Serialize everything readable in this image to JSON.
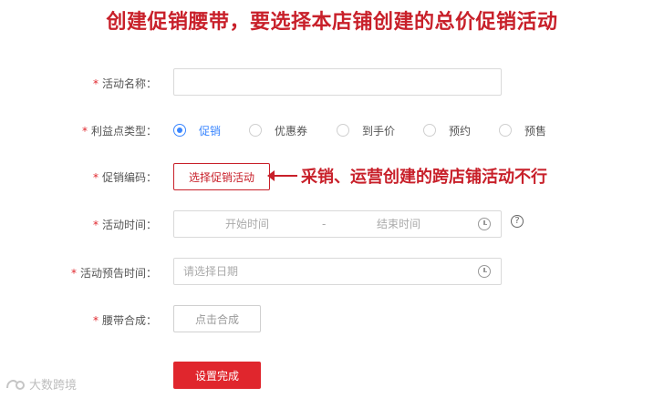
{
  "headline": "创建促销腰带，要选择本店铺创建的总价促销活动",
  "form": {
    "activity_name": {
      "label": "活动名称：",
      "value": "",
      "placeholder": ""
    },
    "benefit_type": {
      "label": "利益点类型：",
      "options": [
        "促销",
        "优惠券",
        "到手价",
        "预约",
        "预售"
      ],
      "selected": "促销"
    },
    "promo_code": {
      "label": "促销编码：",
      "button_label": "选择促销活动"
    },
    "activity_time": {
      "label": "活动时间：",
      "start_placeholder": "开始时间",
      "separator": "-",
      "end_placeholder": "结束时间"
    },
    "preview_time": {
      "label": "活动预告时间：",
      "placeholder": "请选择日期"
    },
    "banner": {
      "label": "腰带合成：",
      "button_label": "点击合成"
    },
    "submit_label": "设置完成",
    "required_mark": "*"
  },
  "annotation": "采销、运营创建的跨店铺活动不行",
  "help_glyph": "?",
  "watermark": "大数跨境",
  "colors": {
    "accent_red": "#e0262d",
    "annotation_red": "#c8202a",
    "radio_blue": "#3a86ff"
  }
}
